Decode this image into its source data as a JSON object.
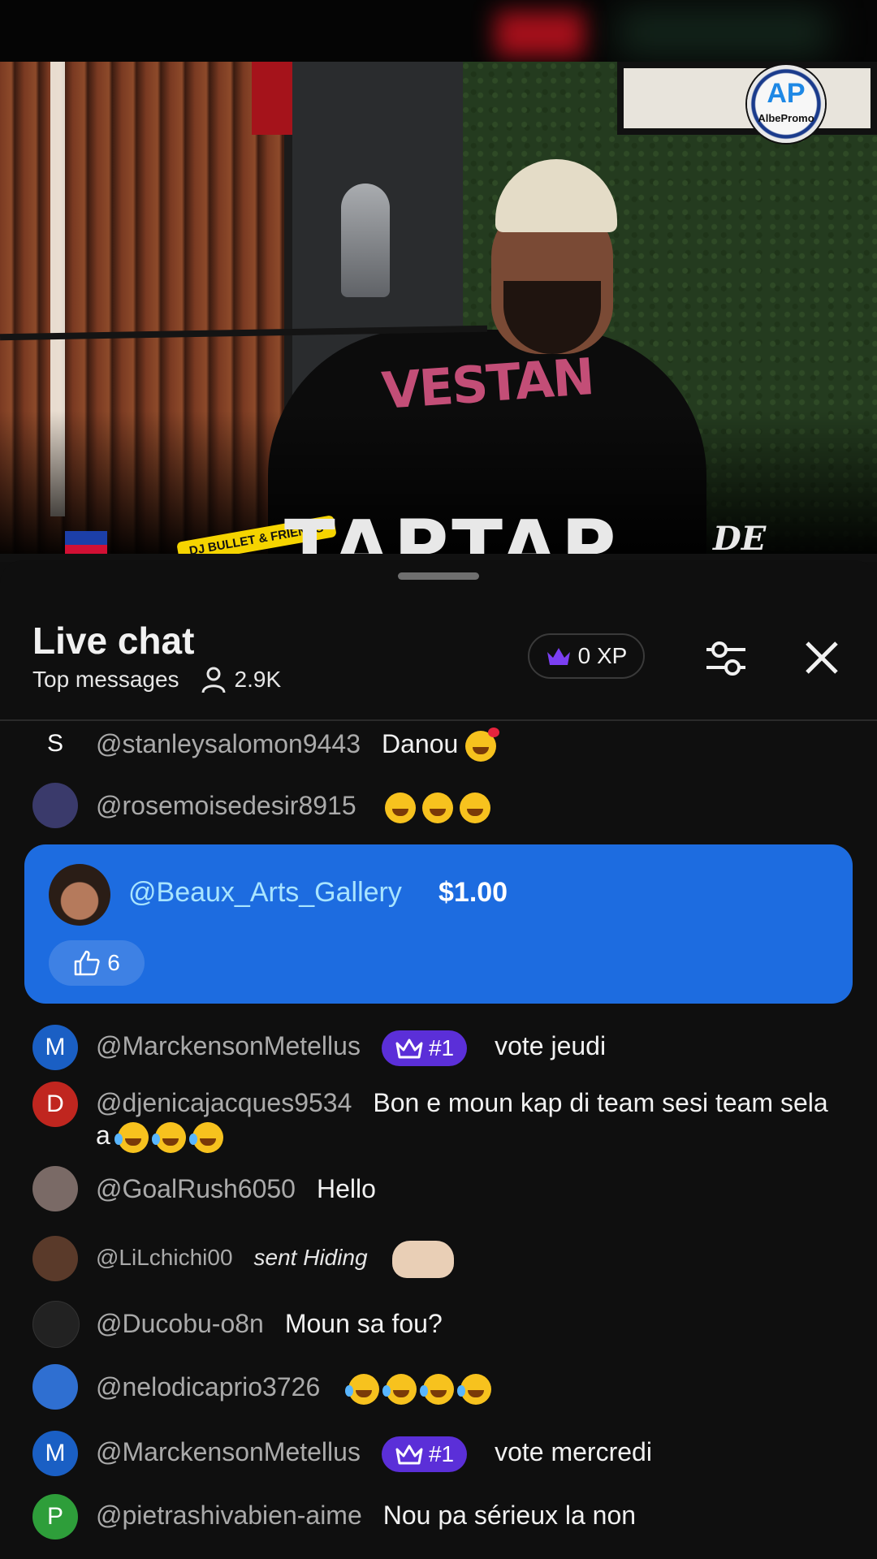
{
  "video": {
    "channel_logo_text": "AP",
    "channel_logo_name": "AlbePromo",
    "overlay_title": "TAPTAP",
    "overlay_badge": "DJ BULLET & FRIENDS",
    "overlay_corner": "DE TOUT&",
    "shirt_text": "VESTAN"
  },
  "chat": {
    "title": "Live chat",
    "mode": "Top messages",
    "viewer_count": "2.9K",
    "xp_label": "0 XP",
    "colors": {
      "accent_blue": "#1d6ce0",
      "member_purple": "#5b2fd8",
      "background": "#0f0f0f"
    },
    "icons": [
      "crown-icon",
      "settings-sliders-icon",
      "close-icon",
      "person-icon",
      "thumbs-up-icon"
    ]
  },
  "messages": [
    {
      "author": "@stanleysalomon9443",
      "avatar_letter": "S",
      "avatar_color": "#4b7b8c",
      "text": "Danou"
    },
    {
      "author": "@rosemoisedesir8915",
      "avatar_letter": "",
      "avatar_color": "#3a3a6b",
      "text": ""
    },
    {
      "author": "@MarckensonMetellus",
      "avatar_letter": "M",
      "avatar_color": "#1a5fc4",
      "badge": "#1",
      "text": "vote jeudi"
    },
    {
      "author": "@djenicajacques9534",
      "avatar_letter": "D",
      "avatar_color": "#c0261f",
      "text": "Bon e moun kap di team sesi team sela a"
    },
    {
      "author": "@GoalRush6050",
      "avatar_letter": "",
      "avatar_color": "#7a6a66",
      "text": "Hello"
    },
    {
      "author": "@LiLchichi00",
      "avatar_letter": "",
      "avatar_color": "#5a3a2a",
      "text": "sent Hiding"
    },
    {
      "author": "@Ducobu-o8n",
      "avatar_letter": "",
      "avatar_color": "#222222",
      "text": "Moun sa fou?"
    },
    {
      "author": "@nelodicaprio3726",
      "avatar_letter": "",
      "avatar_color": "#2f6fd1",
      "text": ""
    },
    {
      "author": "@MarckensonMetellus",
      "avatar_letter": "M",
      "avatar_color": "#1a5fc4",
      "badge": "#1",
      "text": "vote mercredi"
    },
    {
      "author": "@pietrashivabien-aime",
      "avatar_letter": "P",
      "avatar_color": "#2e9e3a",
      "text": "Nou pa sérieux la non"
    }
  ],
  "super_chat": {
    "author": "@Beaux_Arts_Gallery",
    "amount": "$1.00",
    "likes": "6"
  }
}
